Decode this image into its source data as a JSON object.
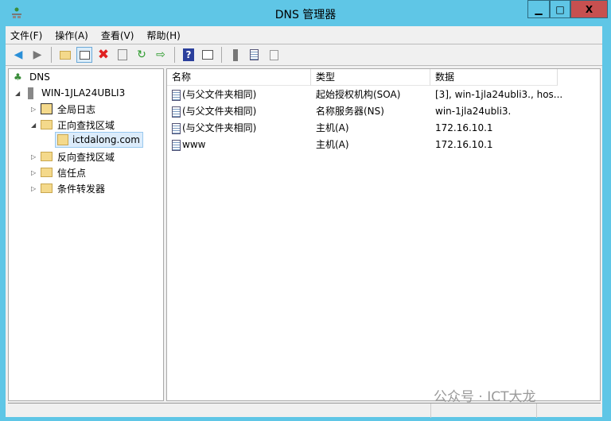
{
  "window": {
    "title": "DNS 管理器",
    "minimize": "▁",
    "maximize": "□",
    "close": "X"
  },
  "menu": [
    "文件(F)",
    "操作(A)",
    "查看(V)",
    "帮助(H)"
  ],
  "toolbar": [
    "back-icon",
    "forward-icon",
    "up-folder-icon",
    "show-hide-tree-icon",
    "delete-icon",
    "properties-icon",
    "refresh-icon",
    "export-icon",
    "help-icon",
    "show-action-pane-icon",
    "server-icon",
    "records-icon",
    "copy-icon"
  ],
  "tree": {
    "root": "DNS",
    "server": "WIN-1JLA24UBLI3",
    "items": [
      {
        "label": "全局日志"
      },
      {
        "label": "正向查找区域"
      },
      {
        "label": "ictdalong.com"
      },
      {
        "label": "反向查找区域"
      },
      {
        "label": "信任点"
      },
      {
        "label": "条件转发器"
      }
    ]
  },
  "columns": [
    "名称",
    "类型",
    "数据"
  ],
  "rows": [
    {
      "name": "(与父文件夹相同)",
      "type": "起始授权机构(SOA)",
      "data": "[3], win-1jla24ubli3., hos..."
    },
    {
      "name": "(与父文件夹相同)",
      "type": "名称服务器(NS)",
      "data": "win-1jla24ubli3."
    },
    {
      "name": "(与父文件夹相同)",
      "type": "主机(A)",
      "data": "172.16.10.1"
    },
    {
      "name": "www",
      "type": "主机(A)",
      "data": "172.16.10.1"
    }
  ],
  "watermark": "公众号 · ICT大龙"
}
